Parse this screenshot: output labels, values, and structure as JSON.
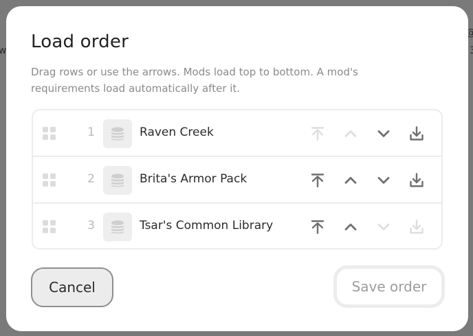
{
  "backdrop": {
    "left_glyph": "w",
    "right_glyph_1": "@",
    "right_glyph_2": "3"
  },
  "dialog": {
    "title": "Load order",
    "description": "Drag rows or use the arrows. Mods load top to bottom. A mod's requirements load automatically after it.",
    "mods": [
      {
        "position": "1",
        "name": "Raven Creek",
        "can_move_top": false,
        "can_move_up": false,
        "can_move_down": true,
        "can_move_bottom": true
      },
      {
        "position": "2",
        "name": "Brita's Armor Pack",
        "can_move_top": true,
        "can_move_up": true,
        "can_move_down": true,
        "can_move_bottom": true
      },
      {
        "position": "3",
        "name": "Tsar's Common Library",
        "can_move_top": true,
        "can_move_up": true,
        "can_move_down": false,
        "can_move_bottom": false
      }
    ],
    "cancel_label": "Cancel",
    "save_label": "Save order",
    "save_enabled": false
  },
  "icons": {
    "drag": "drag-handle-icon",
    "mod": "stack-layers-icon",
    "top": "move-to-top-icon",
    "up": "chevron-up-icon",
    "down": "chevron-down-icon",
    "bottom": "move-to-bottom-icon"
  },
  "colors": {
    "overlay": "#7a7a7a",
    "dialog_bg": "#ffffff",
    "icon_enabled": "#6f6f6f",
    "icon_disabled": "#dedede"
  }
}
